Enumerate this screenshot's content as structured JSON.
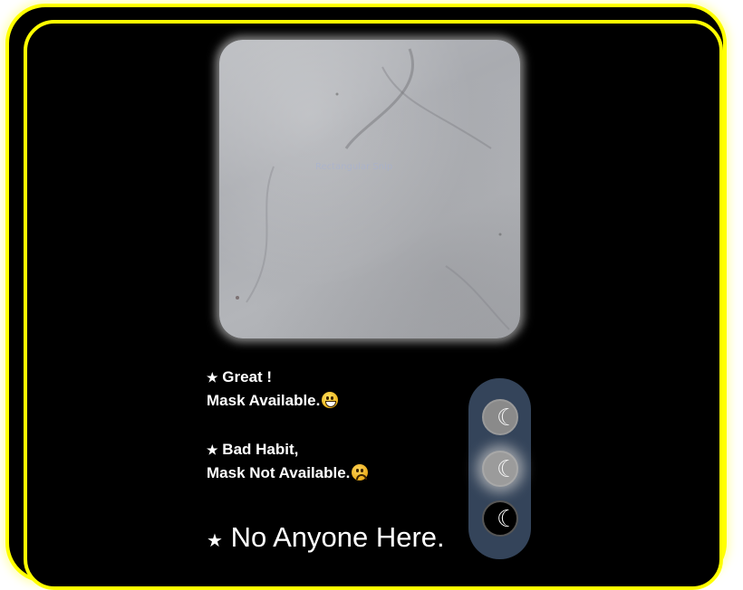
{
  "camera": {
    "watermark_text": "Rectangular Snip"
  },
  "status": {
    "great_line1": "Great !",
    "great_line2": "Mask Available.",
    "bad_line1": "Bad Habit,",
    "bad_line2": "Mask Not Available.",
    "none": "No Anyone Here.",
    "star": "★"
  },
  "traffic_light": {
    "icon": "☾"
  },
  "colors": {
    "frame": "#ffff00",
    "background": "#000000",
    "pill": "#34445a",
    "text": "#ffffff"
  }
}
